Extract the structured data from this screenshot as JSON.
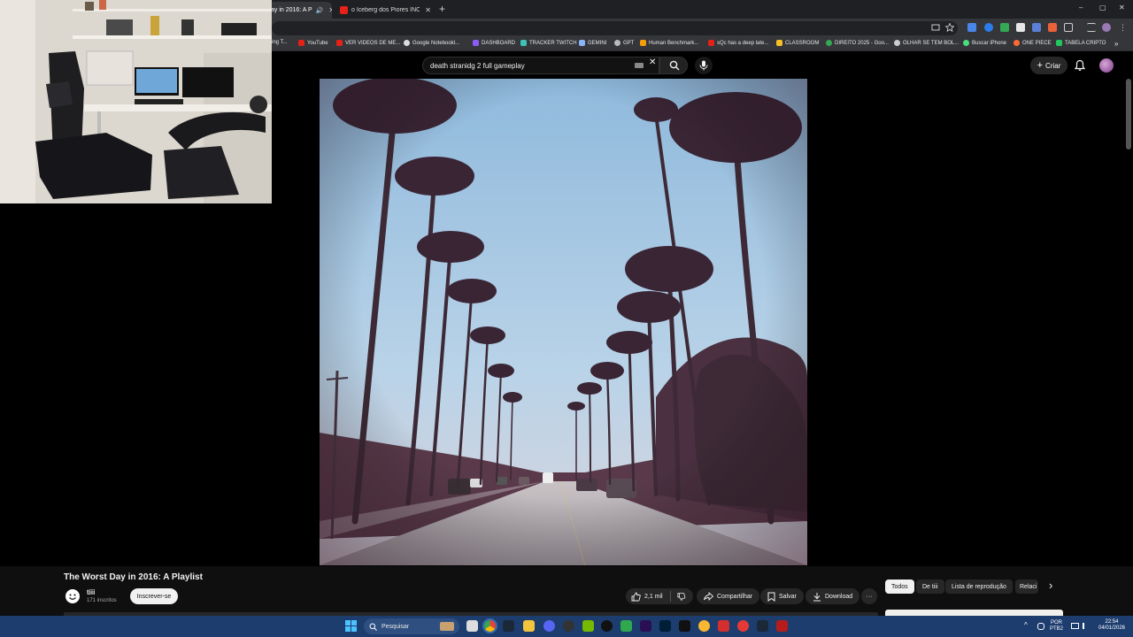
{
  "browser": {
    "tabs": [
      {
        "title": "ay in 2016: A P",
        "active": true
      },
      {
        "title": "o Iceberg dos Piores INCIDENT",
        "active": false
      }
    ],
    "new_tab": "+",
    "window_controls": {
      "minimize": "–",
      "maximize": "▢",
      "close": "✕"
    },
    "bookmarks": [
      {
        "label": "ing T...",
        "color": "#888888"
      },
      {
        "label": "YouTube",
        "color": "#e62117"
      },
      {
        "label": "VER VIDEOS DE ME...",
        "color": "#e62117"
      },
      {
        "label": "Google Notebookl...",
        "color": "#dddddd"
      },
      {
        "label": "DASHBOARD",
        "color": "#8b5cf6"
      },
      {
        "label": "TRACKER TWITCH",
        "color": "#3ec2b5"
      },
      {
        "label": "GEMINI",
        "color": "#8ab4f8"
      },
      {
        "label": "GPT",
        "color": "#bbbbbb"
      },
      {
        "label": "Human Benchmark...",
        "color": "#f59e0b"
      },
      {
        "label": "sQc has a deep late...",
        "color": "#e62117"
      },
      {
        "label": "CLASSROOM",
        "color": "#f6c026"
      },
      {
        "label": "DIREITO 2025 - Goo...",
        "color": "#34a853"
      },
      {
        "label": "OLHAR SE TEM BOL...",
        "color": "#cccccc"
      },
      {
        "label": "Buscar iPhone",
        "color": "#4ade80"
      },
      {
        "label": "ONE PIECE",
        "color": "#ff6b35"
      },
      {
        "label": "TABELA CRIPTO",
        "color": "#22c55e"
      }
    ]
  },
  "youtube": {
    "search": {
      "value": "death stranidg 2 full gameplay",
      "clear": "✕"
    },
    "create_label": "Criar",
    "create_icon": "+",
    "video": {
      "title": "The Worst Day in 2016: A Playlist",
      "channel": "tiii",
      "subscribers": "171 inscritos",
      "subscribe_label": "Inscrever-se"
    },
    "actions": {
      "likes": "2,1 mil",
      "share": "Compartilhar",
      "save": "Salvar",
      "download": "Download",
      "more": "···"
    },
    "chips": [
      "Todos",
      "De tiii",
      "Lista de reprodução",
      "Relaci"
    ],
    "chips_next": "›"
  },
  "taskbar": {
    "search_placeholder": "Pesquisar",
    "language": "POR",
    "layout": "PTB2",
    "time": "22:54",
    "date": "04/01/2026",
    "tray_caret": "^"
  }
}
